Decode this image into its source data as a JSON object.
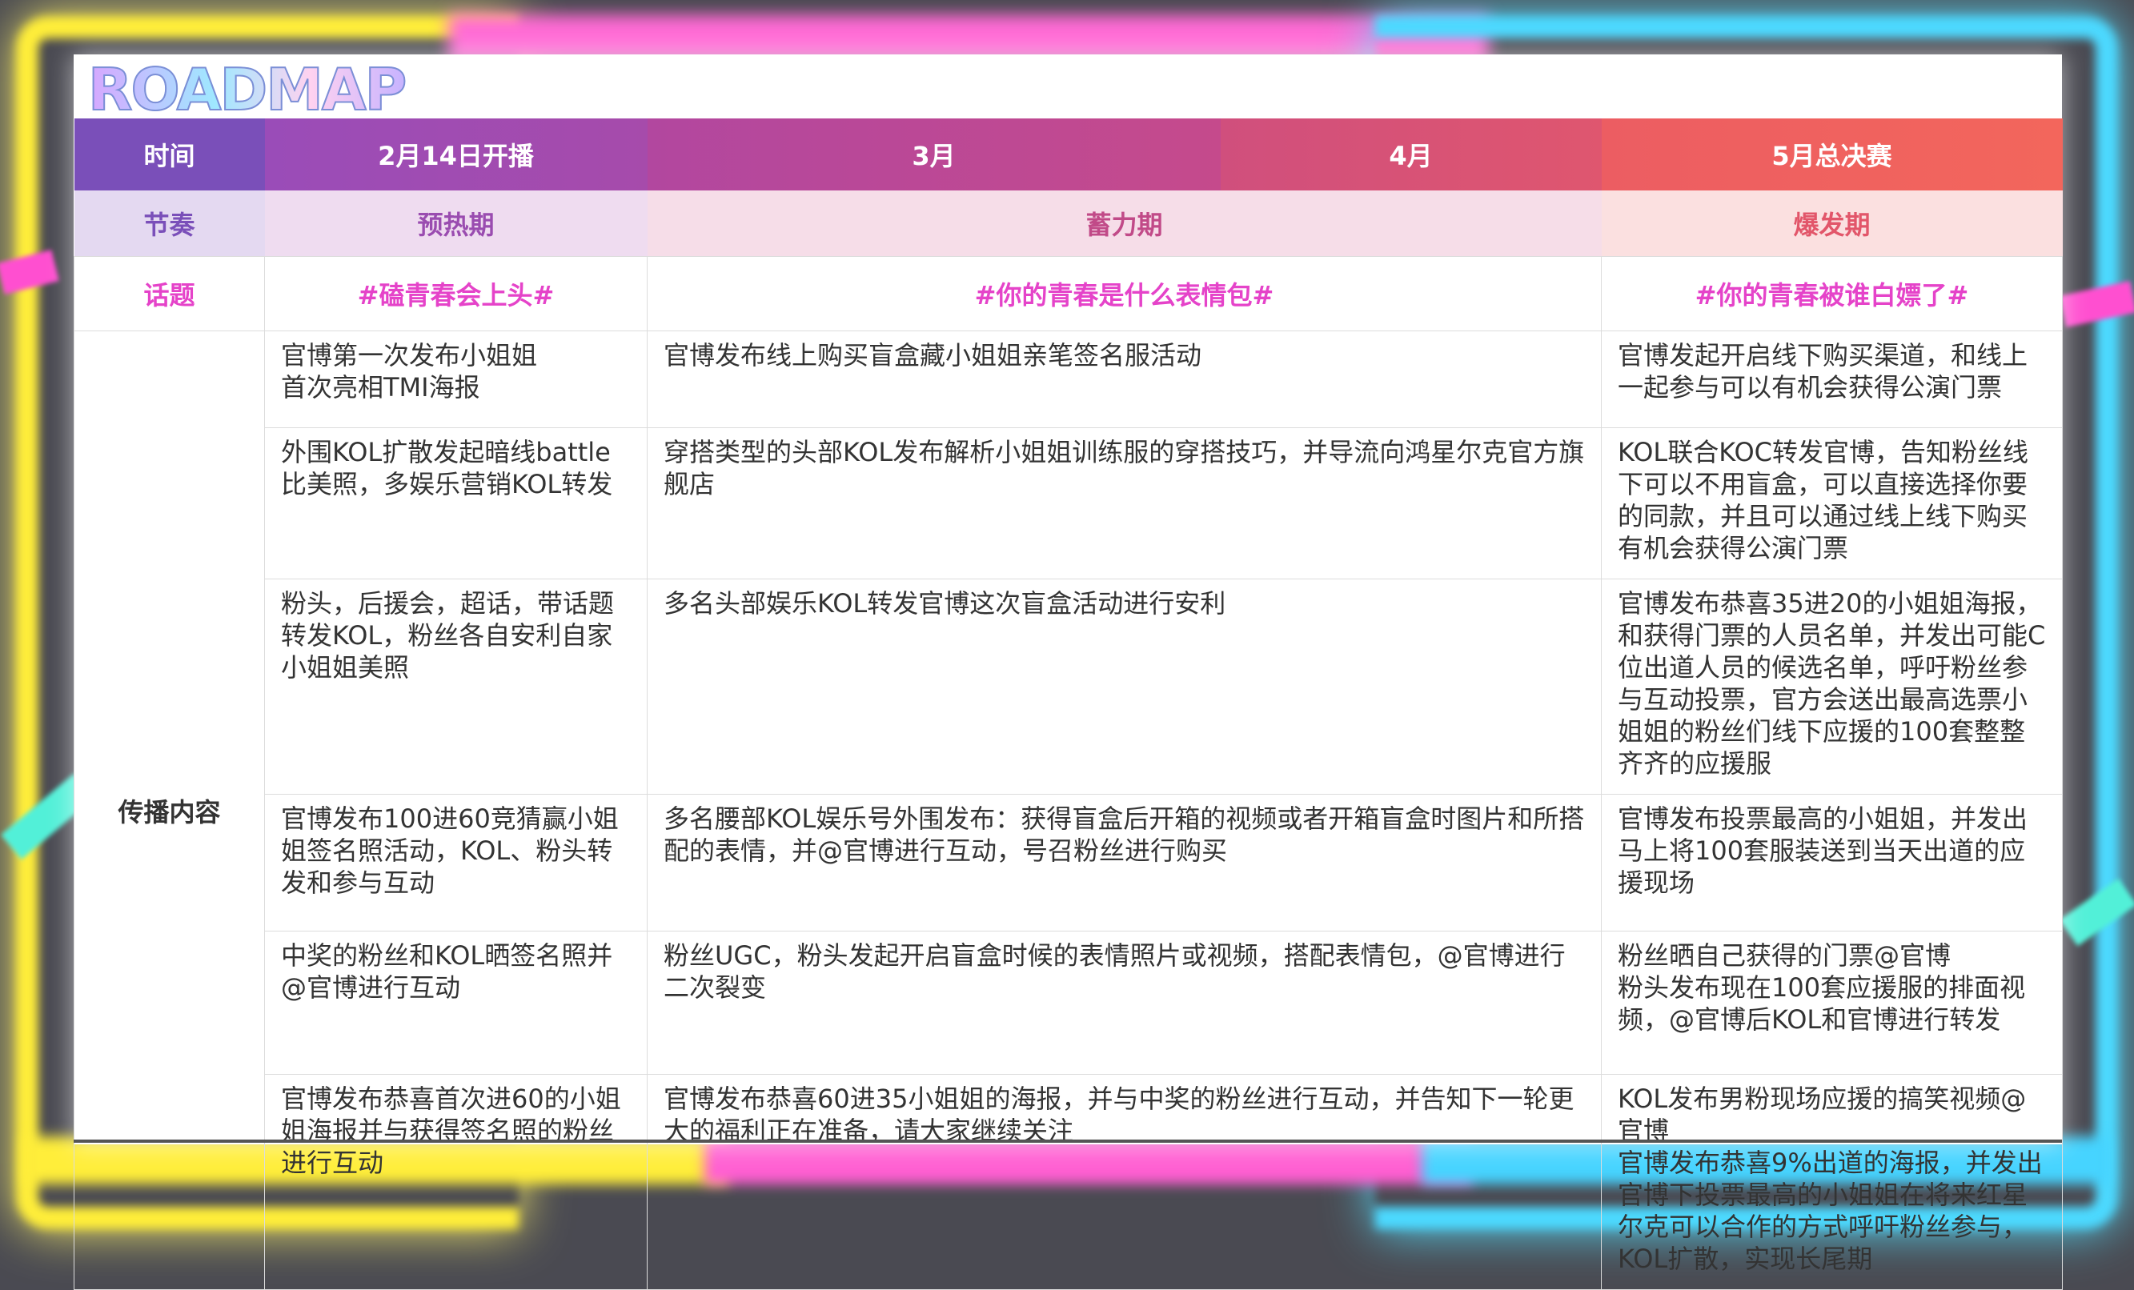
{
  "title": "ROADMAP",
  "colors": {
    "time_label_bg": "#7a4fb9",
    "feb_bg": "#9a4cb0",
    "mar_bg": "#b8479b",
    "apr_bg": "#d9517b",
    "may_bg": "#f0625f"
  },
  "header": {
    "time_label": "时间",
    "phases": [
      "2月14日开播",
      "3月",
      "4月",
      "5月总决赛"
    ]
  },
  "rhythm": {
    "label": "节奏",
    "stages": [
      "预热期",
      "蓄力期",
      "爆发期"
    ]
  },
  "topic": {
    "label": "话题",
    "items": [
      "#磕青春会上头#",
      "#你的青春是什么表情包#",
      "#你的青春被谁白嫖了#"
    ]
  },
  "content": {
    "label": "传播内容",
    "rows": [
      [
        "官博第一次发布小姐姐\n首次亮相TMI海报",
        "官博发布线上购买盲盒藏小姐姐亲笔签名服活动",
        "官博发起开启线下购买渠道，和线上一起参与可以有机会获得公演门票"
      ],
      [
        "外围KOL扩散发起暗线battle比美照，多娱乐营销KOL转发",
        "穿搭类型的头部KOL发布解析小姐姐训练服的穿搭技巧，并导流向鸿星尔克官方旗舰店",
        "KOL联合KOC转发官博，告知粉丝线下可以不用盲盒，可以直接选择你要的同款，并且可以通过线上线下购买有机会获得公演门票"
      ],
      [
        "粉头，后援会，超话，带话题转发KOL，粉丝各自安利自家小姐姐美照",
        "多名头部娱乐KOL转发官博这次盲盒活动进行安利",
        "官博发布恭喜35进20的小姐姐海报，和获得门票的人员名单，并发出可能C位出道人员的候选名单，呼吁粉丝参与互动投票，官方会送出最高选票小姐姐的粉丝们线下应援的100套整整齐齐的应援服"
      ],
      [
        "官博发布100进60竞猜赢小姐姐签名照活动，KOL、粉头转发和参与互动",
        "多名腰部KOL娱乐号外围发布：获得盲盒后开箱的视频或者开箱盲盒时图片和所搭配的表情，并@官博进行互动，号召粉丝进行购买",
        "官博发布投票最高的小姐姐，并发出马上将100套服装送到当天出道的应援现场"
      ],
      [
        "中奖的粉丝和KOL晒签名照并@官博进行互动",
        "粉丝UGC，粉头发起开启盲盒时候的表情照片或视频，搭配表情包，@官博进行二次裂变",
        "粉丝晒自己获得的门票@官博\n粉头发布现在100套应援服的排面视频，@官博后KOL和官博进行转发"
      ],
      [
        "官博发布恭喜首次进60的小姐姐海报并与获得签名照的粉丝进行互动",
        "官博发布恭喜60进35小姐姐的海报，并与中奖的粉丝进行互动，并告知下一轮更大的福利正在准备，请大家继续关注",
        "KOL发布男粉现场应援的搞笑视频@官博\n官博发布恭喜9%出道的海报，并发出官博下投票最高的小姐姐在将来红星尔克可以合作的方式呼吁粉丝参与，KOL扩散，实现长尾期"
      ]
    ]
  }
}
